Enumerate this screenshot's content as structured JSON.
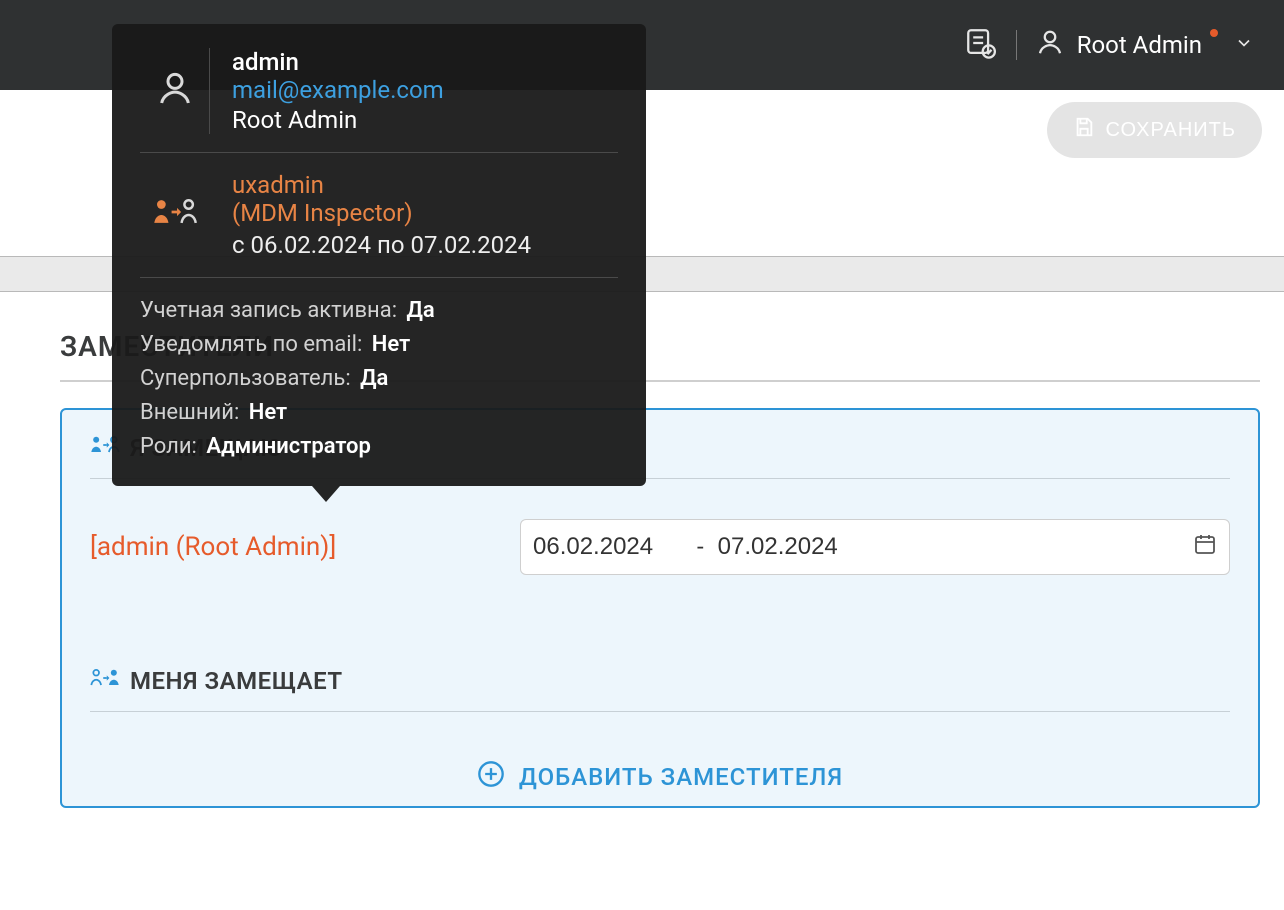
{
  "header": {
    "user_display": "Root Admin"
  },
  "toolbar": {
    "save_label": "СОХРАНИТЬ"
  },
  "section": {
    "title": "ЗАМЕСТИТЕЛИ"
  },
  "panel": {
    "i_substitute_label": "Я ЗАМЕЩАЮ",
    "substitute_me_label": "МЕНЯ ЗАМЕЩАЕТ",
    "add_substitute_label": "ДОБАВИТЬ ЗАМЕСТИТЕЛЯ",
    "entry": {
      "user_link": "[admin (Root Admin)]",
      "date_from": "06.02.2024",
      "date_to": "07.02.2024",
      "range_separator": "-"
    }
  },
  "popover": {
    "username": "admin",
    "email": "mail@example.com",
    "display_name": "Root Admin",
    "deputy_login": "uxadmin",
    "deputy_role": "(MDM Inspector)",
    "period": "с 06.02.2024 по 07.02.2024",
    "props": {
      "active_label": "Учетная запись активна",
      "active_value": "Да",
      "notify_label": "Уведомлять по email",
      "notify_value": "Нет",
      "superuser_label": "Суперпользователь",
      "superuser_value": "Да",
      "external_label": "Внешний",
      "external_value": "Нет",
      "roles_label": "Роли",
      "roles_value": "Администратор"
    }
  }
}
